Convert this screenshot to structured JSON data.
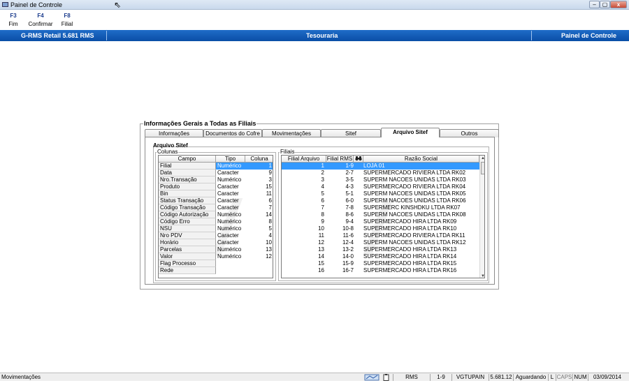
{
  "window": {
    "title": "Painel de Controle"
  },
  "fkeys": [
    {
      "key": "F3",
      "label": "Fim"
    },
    {
      "key": "F4",
      "label": "Confirmar"
    },
    {
      "key": "F8",
      "label": "Filial"
    }
  ],
  "band": {
    "left": "G-RMS Retail 5.681 RMS",
    "center": "Tesouraria",
    "right": "Painel de Controle"
  },
  "group": {
    "title": "Informações Gerais a Todas as Filiais"
  },
  "tabs": [
    "Informações",
    "Documentos do Cofre",
    "Movimentações",
    "Sitef",
    "Arquivo  Sitef",
    "Outros"
  ],
  "active_tab": "Arquivo  Sitef",
  "section": {
    "title": "Arquivo Sitef",
    "colunas_label": "Colunas",
    "filiais_label": "Filiais"
  },
  "colunas_table": {
    "headers": [
      "Campo",
      "Tipo",
      "Coluna"
    ],
    "rows": [
      {
        "campo": "Filial",
        "tipo": "Numérico",
        "coluna": "1"
      },
      {
        "campo": "Data",
        "tipo": "Caracter",
        "coluna": "9"
      },
      {
        "campo": "Nro.Transação",
        "tipo": "Numérico",
        "coluna": "3"
      },
      {
        "campo": "Produto",
        "tipo": "Caracter",
        "coluna": "15"
      },
      {
        "campo": "Bin",
        "tipo": "Caracter",
        "coluna": "11"
      },
      {
        "campo": "Status Transação",
        "tipo": "Caracter",
        "coluna": "6"
      },
      {
        "campo": "Código Transação",
        "tipo": "Caracter",
        "coluna": "7"
      },
      {
        "campo": "Código Autorização",
        "tipo": "Numérico",
        "coluna": "14"
      },
      {
        "campo": "Código Erro",
        "tipo": "Numérico",
        "coluna": "8"
      },
      {
        "campo": "NSU",
        "tipo": "Numérico",
        "coluna": "5"
      },
      {
        "campo": "Nro PDV",
        "tipo": "Caracter",
        "coluna": "4"
      },
      {
        "campo": "Horário",
        "tipo": "Caracter",
        "coluna": "10"
      },
      {
        "campo": "Parcelas",
        "tipo": "Numérico",
        "coluna": "13"
      },
      {
        "campo": "Valor",
        "tipo": "Numérico",
        "coluna": "12"
      },
      {
        "campo": "Flag Processo",
        "tipo": "",
        "coluna": ""
      },
      {
        "campo": "Rede",
        "tipo": "",
        "coluna": ""
      }
    ]
  },
  "filiais_table": {
    "headers": [
      "Filial Arquivo",
      "Filial RMS",
      "Razão Social"
    ],
    "rows": [
      {
        "arquivo": "1",
        "rms": "1-9",
        "razao": "LOJA 01"
      },
      {
        "arquivo": "2",
        "rms": "2-7",
        "razao": "SUPERMERCADO RIVIERA LTDA RK02"
      },
      {
        "arquivo": "3",
        "rms": "3-5",
        "razao": "SUPERM NACOES UNIDAS LTDA RK03"
      },
      {
        "arquivo": "4",
        "rms": "4-3",
        "razao": "SUPERMERCADO RIVIERA LTDA RK04"
      },
      {
        "arquivo": "5",
        "rms": "5-1",
        "razao": "SUPERM NACOES UNIDAS LTDA RK05"
      },
      {
        "arquivo": "6",
        "rms": "6-0",
        "razao": "SUPERM NACOES UNIDAS LTDA RK06"
      },
      {
        "arquivo": "7",
        "rms": "7-8",
        "razao": "SUPERMERC KINSHDKU LTDA RK07"
      },
      {
        "arquivo": "8",
        "rms": "8-6",
        "razao": "SUPERM NACOES UNIDAS LTDA RK08"
      },
      {
        "arquivo": "9",
        "rms": "9-4",
        "razao": "SUPERMERCADO HIRA LTDA RK09"
      },
      {
        "arquivo": "10",
        "rms": "10-8",
        "razao": "SUPERMERCADO HIRA LTDA RK10"
      },
      {
        "arquivo": "11",
        "rms": "11-6",
        "razao": "SUPERMERCADO RIVIERA LTDA RK11"
      },
      {
        "arquivo": "12",
        "rms": "12-4",
        "razao": "SUPERM NACOES UNIDAS LTDA RK12"
      },
      {
        "arquivo": "13",
        "rms": "13-2",
        "razao": "SUPERMERCADO HIRA LTDA RK13"
      },
      {
        "arquivo": "14",
        "rms": "14-0",
        "razao": "SUPERMERCADO HIRA LTDA RK14"
      },
      {
        "arquivo": "15",
        "rms": "15-9",
        "razao": "SUPERMERCADO HIRA LTDA RK15"
      },
      {
        "arquivo": "16",
        "rms": "16-7",
        "razao": "SUPERMERCADO HIRA LTDA RK16"
      }
    ]
  },
  "statusbar": {
    "message": "Movimentações",
    "module": "RMS",
    "filial": "1-9",
    "program": "VGTUPAIN",
    "version": "5.681.12",
    "state": "Aguardando",
    "l": "L",
    "caps": "CAPS",
    "num": "NUM",
    "date": "03/09/2014"
  }
}
